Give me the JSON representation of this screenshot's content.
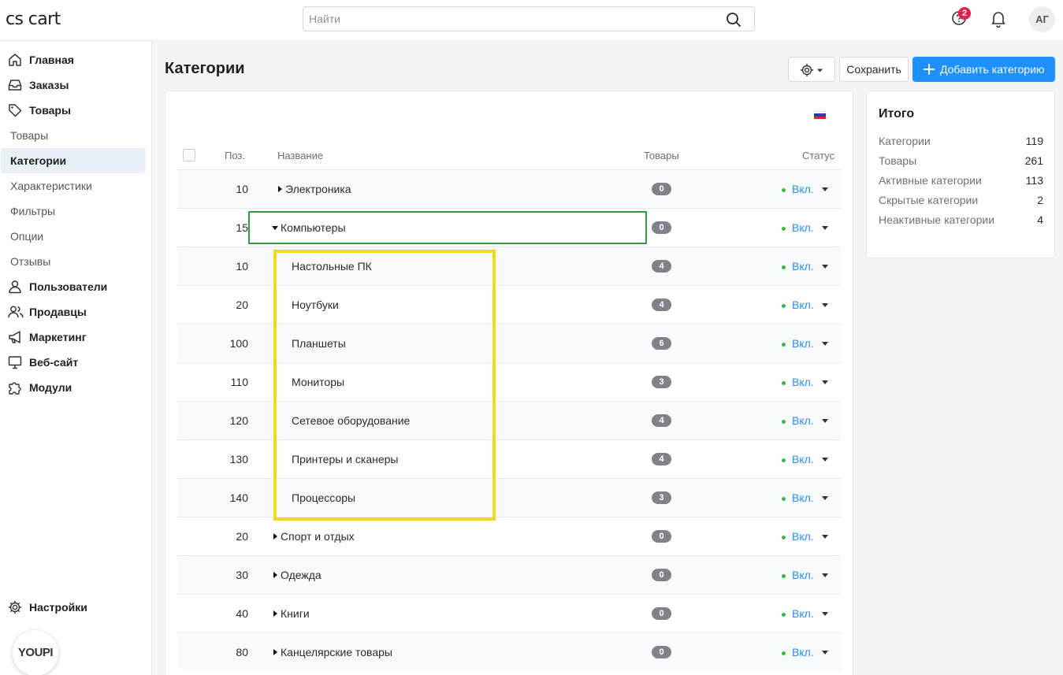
{
  "topbar": {
    "logo": "cs cart",
    "search_placeholder": "Найти",
    "notif_badge": "2",
    "avatar_initials": "АГ"
  },
  "sidebar": {
    "items": [
      {
        "label": "Главная",
        "icon": "home-icon"
      },
      {
        "label": "Заказы",
        "icon": "inbox-icon"
      },
      {
        "label": "Товары",
        "icon": "tag-icon"
      },
      {
        "label": "Товары",
        "sub": true
      },
      {
        "label": "Категории",
        "sub": true,
        "active": true
      },
      {
        "label": "Характеристики",
        "sub": true
      },
      {
        "label": "Фильтры",
        "sub": true
      },
      {
        "label": "Опции",
        "sub": true
      },
      {
        "label": "Отзывы",
        "sub": true
      },
      {
        "label": "Пользователи",
        "icon": "user-icon"
      },
      {
        "label": "Продавцы",
        "icon": "users-icon"
      },
      {
        "label": "Маркетинг",
        "icon": "megaphone-icon"
      },
      {
        "label": "Веб-сайт",
        "icon": "monitor-icon"
      },
      {
        "label": "Модули",
        "icon": "puzzle-icon"
      }
    ],
    "settings_label": "Настройки",
    "widget_label": "YOUPI"
  },
  "header": {
    "title": "Категории",
    "save_label": "Сохранить",
    "add_label": "Добавить категорию"
  },
  "table": {
    "headers": {
      "pos": "Поз.",
      "name": "Название",
      "products": "Товары",
      "status": "Статус"
    },
    "rows": [
      {
        "pos": "10",
        "name": "Электроника",
        "count": "0",
        "status": "Вкл.",
        "level": 0,
        "expand": "collapsed"
      },
      {
        "pos": "15",
        "name": "Компьютеры",
        "count": "0",
        "status": "Вкл.",
        "level": 0,
        "expand": "expanded"
      },
      {
        "pos": "10",
        "name": "Настольные ПК",
        "count": "4",
        "status": "Вкл.",
        "level": 1
      },
      {
        "pos": "20",
        "name": "Ноутбуки",
        "count": "4",
        "status": "Вкл.",
        "level": 1
      },
      {
        "pos": "100",
        "name": "Планшеты",
        "count": "6",
        "status": "Вкл.",
        "level": 1
      },
      {
        "pos": "110",
        "name": "Мониторы",
        "count": "3",
        "status": "Вкл.",
        "level": 1
      },
      {
        "pos": "120",
        "name": "Сетевое оборудование",
        "count": "4",
        "status": "Вкл.",
        "level": 1
      },
      {
        "pos": "130",
        "name": "Принтеры и сканеры",
        "count": "4",
        "status": "Вкл.",
        "level": 1
      },
      {
        "pos": "140",
        "name": "Процессоры",
        "count": "3",
        "status": "Вкл.",
        "level": 1
      },
      {
        "pos": "20",
        "name": "Спорт и отдых",
        "count": "0",
        "status": "Вкл.",
        "level": 0,
        "expand": "collapsed"
      },
      {
        "pos": "30",
        "name": "Одежда",
        "count": "0",
        "status": "Вкл.",
        "level": 0,
        "expand": "collapsed"
      },
      {
        "pos": "40",
        "name": "Книги",
        "count": "0",
        "status": "Вкл.",
        "level": 0,
        "expand": "collapsed"
      },
      {
        "pos": "80",
        "name": "Канцелярские товары",
        "count": "0",
        "status": "Вкл.",
        "level": 0,
        "expand": "collapsed"
      }
    ]
  },
  "summary": {
    "title": "Итого",
    "rows": [
      {
        "label": "Категории",
        "value": "119"
      },
      {
        "label": "Товары",
        "value": "261"
      },
      {
        "label": "Активные категории",
        "value": "113"
      },
      {
        "label": "Скрытые категории",
        "value": "2"
      },
      {
        "label": "Неактивные категории",
        "value": "4"
      }
    ]
  },
  "colors": {
    "accent": "#1e90ff",
    "status_dot": "#3bb54a",
    "badge_red": "#e4214e",
    "highlight_green": "#2e9e3f",
    "highlight_yellow": "#f5d916"
  }
}
